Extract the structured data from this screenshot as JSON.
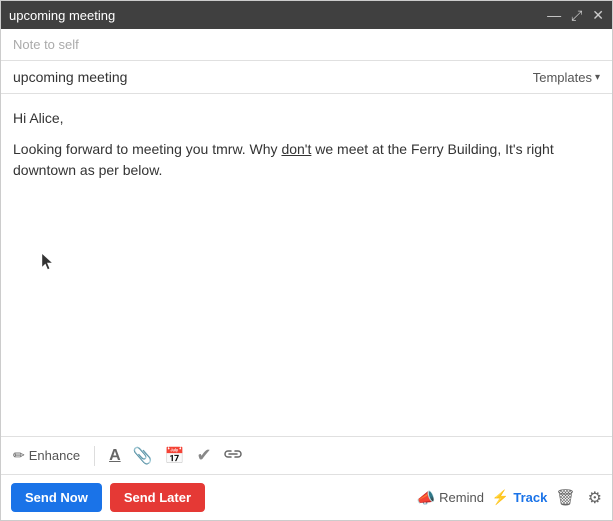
{
  "window": {
    "title": "upcoming meeting",
    "controls": {
      "minimize": "—",
      "expand": "⤢",
      "close": "✕"
    }
  },
  "note_bar": {
    "placeholder": "Note to self"
  },
  "subject": {
    "text": "upcoming meeting",
    "templates_label": "Templates"
  },
  "body": {
    "greeting": "Hi Alice,",
    "paragraph": "Looking forward to meeting you tmrw. Why don't we meet at the Ferry Building, It's right downtown as per below."
  },
  "toolbar": {
    "enhance_label": "Enhance",
    "icons": {
      "pencil": "✏",
      "font": "A",
      "attachment": "📎",
      "calendar": "📅",
      "checkmark": "✓",
      "link": "🔗"
    }
  },
  "actions": {
    "send_now": "Send Now",
    "send_later": "Send Later",
    "remind": "Remind",
    "track": "Track",
    "trash": "🗑",
    "gear": "⚙"
  }
}
